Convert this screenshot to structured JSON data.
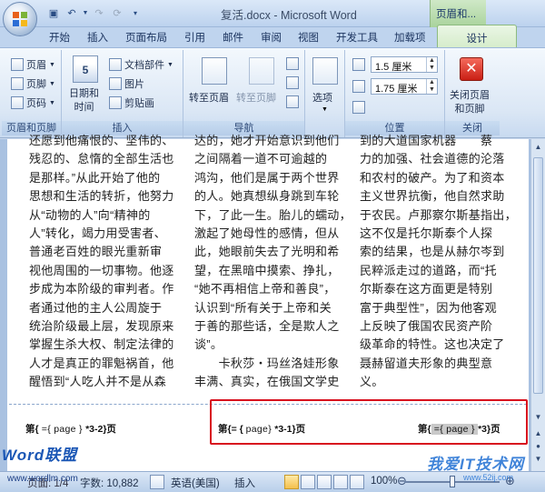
{
  "window": {
    "title": "复活.docx - Microsoft Word",
    "context_tab_title": "页眉和..."
  },
  "tabs": [
    "开始",
    "插入",
    "页面布局",
    "引用",
    "邮件",
    "审阅",
    "视图",
    "开发工具",
    "加载项"
  ],
  "active_tab": "设计",
  "ribbon": {
    "groups": [
      {
        "label": "页眉和页脚",
        "items": [
          "页眉",
          "页脚",
          "页码"
        ]
      },
      {
        "label": "插入",
        "items": [
          "日期和\n时间",
          "文档部件",
          "图片",
          "剪贴画"
        ]
      },
      {
        "label": "导航",
        "items": [
          "转至页眉",
          "转至页脚"
        ]
      },
      {
        "label": "",
        "items": [
          "选项"
        ]
      },
      {
        "label": "位置",
        "items": [
          "1.5 厘米",
          "1.75 厘米"
        ]
      },
      {
        "label": "关闭",
        "items": [
          "关闭页眉\n和页脚"
        ]
      }
    ],
    "header_margin": "1.5 厘米",
    "footer_margin": "1.75 厘米",
    "options_label": "选项",
    "close_label_1": "关闭页眉",
    "close_label_2": "和页脚",
    "goto_header": "转至页眉",
    "goto_footer": "转至页脚",
    "date_time_1": "日期和",
    "date_time_2": "时间",
    "doc_parts": "文档部件",
    "picture": "图片",
    "clipart": "剪贴画",
    "header_btn": "页眉",
    "footer_btn": "页脚",
    "pagenum_btn": "页码",
    "group_hf": "页眉和页脚",
    "group_insert": "插入",
    "group_nav": "导航",
    "group_position": "位置",
    "group_close": "关闭"
  },
  "document": {
    "col1": [
      "还愿到他痛恨的、坚伟的、",
      "残忍的、怠惰的全部生活也",
      "是那样。”从此开始了他的",
      "思想和生活的转折，他努力",
      "从“动物的人”向“精神的",
      "人”转化，竭力用受害者、",
      "普通老百姓的眼光重新审",
      "视他周围的一切事物。他逐",
      "步成为本阶级的审判者。作",
      "者通过他的主人公周旋于",
      "统治阶级最上层，发现原来",
      "掌握生杀大权、制定法律的",
      "人才是真正的罪魁祸首，他",
      "醒悟到“人吃人并不是从森"
    ],
    "col2": [
      "达的，她才开始意识到他们",
      "之间隔着一道不可逾越的",
      "鸿沟，他们是属于两个世界",
      "的人。她真想纵身跳到车轮",
      "下，了此一生。胎儿的蠕动，",
      "激起了她母性的感情，但从",
      "此，她眼前失去了光明和希",
      "望，在黑暗中摸索、挣扎，",
      "“她不再相信上帝和善良”，",
      "认识到“所有关于上帝和关",
      "于善的那些话，全是欺人之",
      "谈”。",
      "　　卡秋莎・玛丝洛娃形象",
      "丰满、真实，在俄国文学史"
    ],
    "col3": [
      "到的大道国家机器　　蔡",
      "力的加强、社会道德的沦落",
      "和农村的破产。为了和资本",
      "主义世界抗衡，他自然求助",
      "于农民。卢那察尔斯基指出，",
      "这不仅是托尔斯泰个人探",
      "索的结果，也是从赫尔岑到",
      "民粹派走过的道路，而“托",
      "尔斯泰在这方面更是特别",
      "富于典型性”，因为他客观",
      "上反映了俄国农民资产阶",
      "级革命的特性。这也决定了",
      "聂赫留道夫形象的典型意",
      "义。"
    ]
  },
  "footers": {
    "left": {
      "prefix": "第{",
      "code": " ={ page } ",
      "suffix": "*3-2}页"
    },
    "mid": {
      "prefix": "第{= { ",
      "code": "page} ",
      "suffix": "*3-1}页"
    },
    "right": {
      "prefix": "第{",
      "code": " ={ page } ",
      "suffix": "*3}页"
    }
  },
  "status": {
    "page_text": "页面: 1/4",
    "word_count": "字数: 10,882",
    "language": "英语(美国)",
    "insert_mode": "插入",
    "zoom": "100%"
  },
  "watermarks": {
    "left": "Word联盟",
    "left_sub": "www.wordlm.com",
    "right": "我爱IT技术网",
    "right_sub": "www.52ij.com"
  }
}
